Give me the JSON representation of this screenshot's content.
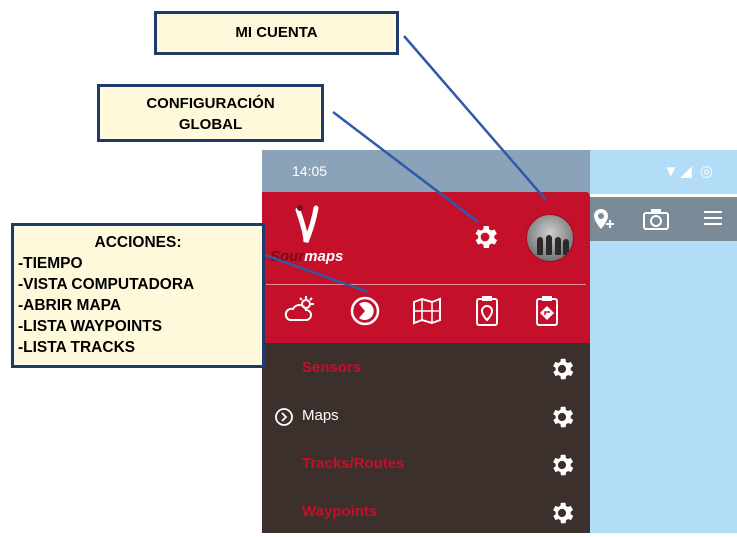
{
  "callouts": {
    "cuenta": "MI CUENTA",
    "config_line1": "CONFIGURACIÓN",
    "config_line2": "GLOBAL",
    "acciones_title": "ACCIONES:",
    "acciones_items": [
      "-TIEMPO",
      "-VISTA COMPUTADORA",
      "-ABRIR MAPA",
      "-LISTA WAYPOINTS",
      "-LISTA TRACKS"
    ]
  },
  "statusbar": {
    "time": "14:05",
    "icons": "▼◢ ◎"
  },
  "logo": {
    "prefix": "Sour",
    "suffix": "maps"
  },
  "actions": [
    "weather-icon",
    "computer-view-icon",
    "open-map-icon",
    "waypoints-list-icon",
    "tracks-list-icon"
  ],
  "menu": [
    {
      "label": "Sensors",
      "active": false
    },
    {
      "label": "Maps",
      "active": true
    },
    {
      "label": "Tracks/Routes",
      "active": false
    },
    {
      "label": "Waypoints",
      "active": false
    }
  ],
  "colors": {
    "brand_red": "#c4102a",
    "drawer_dark": "#3b302b",
    "callout_bg": "#fff9dc",
    "callout_border": "#1f3a6b",
    "map_blue": "#b3dcf7"
  }
}
